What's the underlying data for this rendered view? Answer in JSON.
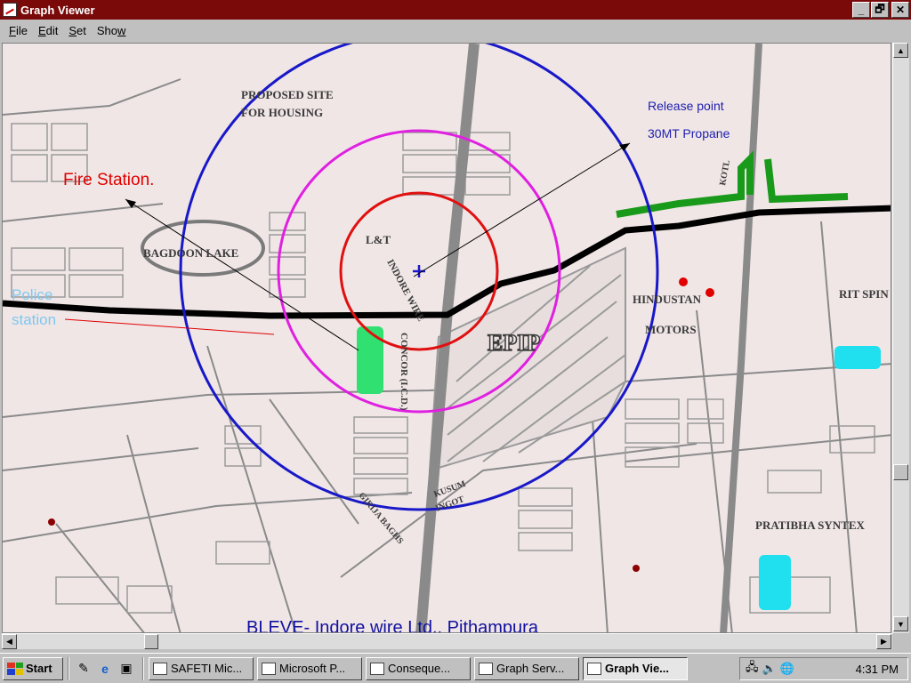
{
  "window": {
    "title": "Graph Viewer",
    "minimize": "_",
    "maximize": "🗗",
    "close": "✕"
  },
  "menu": [
    {
      "label": "File",
      "key": "F",
      "rest": "ile"
    },
    {
      "label": "Edit",
      "key": "E",
      "rest": "dit"
    },
    {
      "label": "Set",
      "key": "S",
      "rest": "et"
    },
    {
      "label": "Show",
      "key": "w",
      "rest": "Sho"
    }
  ],
  "map": {
    "labels": {
      "proposed_site_1": "PROPOSED SITE",
      "proposed_site_2": "FOR HOUSING",
      "lake": "BAGDOON LAKE",
      "lt": "L&T",
      "indore_wire": "INDORE WIRE",
      "concor": "CONCOR (I.C.D.)",
      "epip": "EPIP",
      "hindustan": "HINDUSTAN",
      "motors": "MOTORS",
      "rit": "RIT SPIN",
      "pratibha": "PRATIBHA SYNTEX",
      "kusum1": "KUSUM",
      "kusum2": "INGOT",
      "kotl": "KOTL",
      "girlia": "GIRIJA BAGHS"
    },
    "annotations": {
      "fire_station": "Fire Station.",
      "police_1": "Police",
      "police_2": "station",
      "release_1": "Release point",
      "release_2": "30MT Propane"
    },
    "caption": "BLEVE- Indore wire Ltd., Pithampura",
    "colors": {
      "outer_ring": "#1818c8",
      "middle_ring": "#e020e0",
      "inner_ring": "#e01010",
      "road": "#000000",
      "fire_text": "#e00000",
      "police_text": "#80c8f0",
      "release_text": "#2020b0",
      "caption_text": "#1010a0"
    }
  },
  "taskbar": {
    "start": "Start",
    "tasks": [
      {
        "label": "SAFETI Mic...",
        "active": false
      },
      {
        "label": "Microsoft P...",
        "active": false
      },
      {
        "label": "Conseque...",
        "active": false
      },
      {
        "label": "Graph Serv...",
        "active": false
      },
      {
        "label": "Graph Vie...",
        "active": true
      }
    ],
    "clock": "4:31 PM"
  }
}
